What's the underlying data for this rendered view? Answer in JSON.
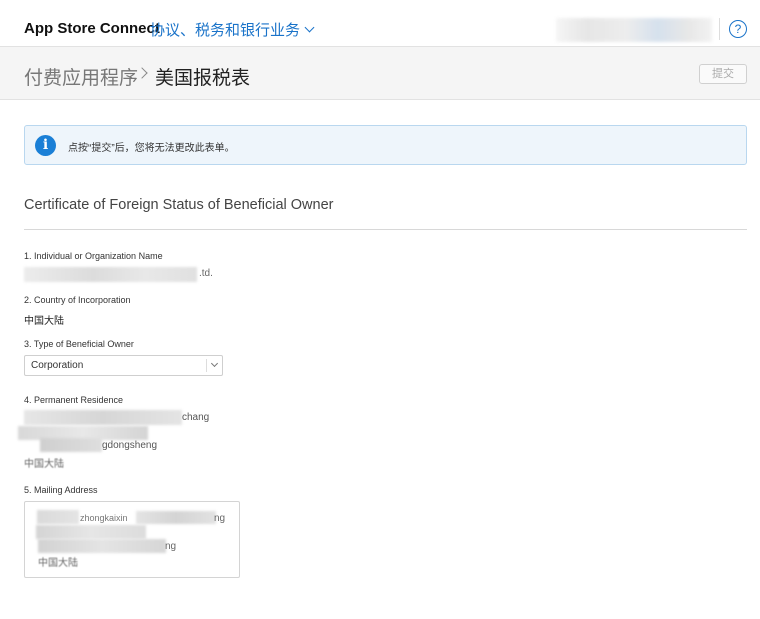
{
  "header": {
    "app_title": "App Store Connect",
    "menu_label": "协议、税务和银行业务",
    "help_label": "?"
  },
  "breadcrumb": {
    "parent": "付费应用程序",
    "current": "美国报税表"
  },
  "toolbar": {
    "submit_label": "提交"
  },
  "notice": {
    "text": "点按“提交”后，您将无法更改此表单。"
  },
  "form": {
    "title": "Certificate of Foreign Status of Beneficial Owner",
    "fields": [
      {
        "label": "1. Individual or Organization Name",
        "value_visible": ".td."
      },
      {
        "label": "2. Country of Incorporation",
        "value": "中国大陆"
      },
      {
        "label": "3. Type of Beneficial Owner",
        "value": "Corporation"
      },
      {
        "label": "4. Permanent Residence",
        "line1_visible": "chang",
        "line2_visible": "gdongsheng",
        "line3_visible": "中国大陆"
      },
      {
        "label": "5. Mailing Address",
        "line1_visible": "zhongkaixin",
        "line1_end": "ng",
        "line3_visible": "ng",
        "line4_visible": "中国大陆"
      }
    ]
  },
  "colors": {
    "accent": "#1a73c9",
    "info_icon": "#1a7fd6",
    "notice_bg": "#eef5fb",
    "notice_border": "#b9d7ef",
    "subbar_bg": "#f5f5f5"
  },
  "icons": [
    "chevron-down-icon",
    "help-icon",
    "chevron-right-icon",
    "info-icon",
    "select-chevron-icon"
  ]
}
